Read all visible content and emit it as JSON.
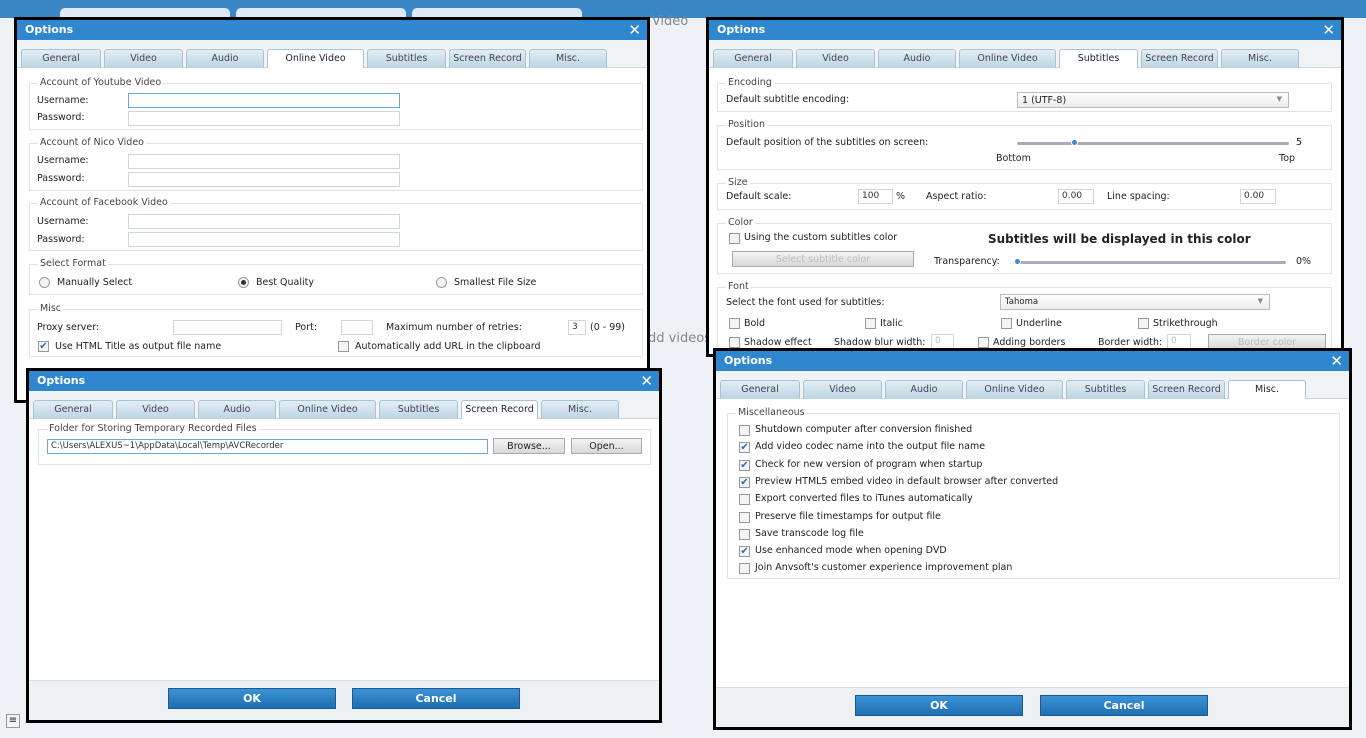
{
  "background": {
    "tab_fragment": "y Video",
    "add_fragment": "dd videos"
  },
  "tabs": [
    "General",
    "Video",
    "Audio",
    "Online Video",
    "Subtitles",
    "Screen Record",
    "Misc."
  ],
  "dialog_title": "Options",
  "online": {
    "active_tab": 3,
    "youtube": "Account of Youtube Video",
    "nico": "Account of Nico Video",
    "facebook": "Account of Facebook Video",
    "username": "Username:",
    "password": "Password:",
    "format": {
      "legend": "Select Format",
      "manual": "Manually Select",
      "best": "Best Quality",
      "smallest": "Smallest File Size",
      "selected": "Best Quality"
    },
    "misc": {
      "legend": "Misc",
      "proxy": "Proxy server:",
      "port": "Port:",
      "retries": "Maximum number of retries:",
      "retries_value": "3",
      "range": "(0 - 99)",
      "html_title": "Use HTML Title as output file name",
      "html_title_checked": true,
      "auto_url": "Automatically add URL in the clipboard",
      "auto_url_checked": false
    }
  },
  "subtitles": {
    "active_tab": 4,
    "encoding": {
      "legend": "Encoding",
      "label": "Default subtitle encoding:",
      "value": "1 (UTF-8)"
    },
    "position": {
      "legend": "Position",
      "label": "Default position of the subtitles on screen:",
      "value": "5",
      "min": "Bottom",
      "max": "Top",
      "fraction": 0.21
    },
    "size": {
      "legend": "Size",
      "scale": "Default scale:",
      "scale_value": "100",
      "pct": "%",
      "aspect": "Aspect ratio:",
      "aspect_value": "0.00",
      "spacing": "Line spacing:",
      "spacing_value": "0.00"
    },
    "color": {
      "legend": "Color",
      "custom": "Using the custom subtitles color",
      "select_btn": "Select subtitle color",
      "preview": "Subtitles will be displayed in this color",
      "transparency": "Transparency:",
      "transparency_value": "0%"
    },
    "font": {
      "legend": "Font",
      "label": "Select the font used for subtitles:",
      "value": "Tahoma",
      "bold": "Bold",
      "italic": "Italic",
      "underline": "Underline",
      "strike": "Strikethrough",
      "shadow": "Shadow effect",
      "blur": "Shadow blur width:",
      "blur_value": "0",
      "borders": "Adding borders",
      "border_width": "Border width:",
      "border_value": "0",
      "border_color": "Border color"
    }
  },
  "screen": {
    "active_tab": 5,
    "legend": "Folder for Storing Temporary Recorded Files",
    "path": "C:\\Users\\ALEXUS~1\\AppData\\Local\\Temp\\AVCRecorder",
    "browse": "Browse...",
    "open": "Open..."
  },
  "misc": {
    "active_tab": 6,
    "legend": "Miscellaneous",
    "items": [
      {
        "label": "Shutdown computer after conversion finished",
        "checked": false
      },
      {
        "label": "Add video codec name into the output file name",
        "checked": true
      },
      {
        "label": "Check for new version of program when startup",
        "checked": true
      },
      {
        "label": "Preview HTML5 embed video in default browser after converted",
        "checked": true
      },
      {
        "label": "Export converted files to iTunes automatically",
        "checked": false
      },
      {
        "label": "Preserve file timestamps for output file",
        "checked": false
      },
      {
        "label": "Save transcode log file",
        "checked": false
      },
      {
        "label": "Use enhanced mode when opening DVD",
        "checked": true
      },
      {
        "label": "Join Anvsoft's customer experience improvement plan",
        "checked": false
      }
    ]
  },
  "buttons": {
    "ok": "OK",
    "cancel": "Cancel"
  }
}
